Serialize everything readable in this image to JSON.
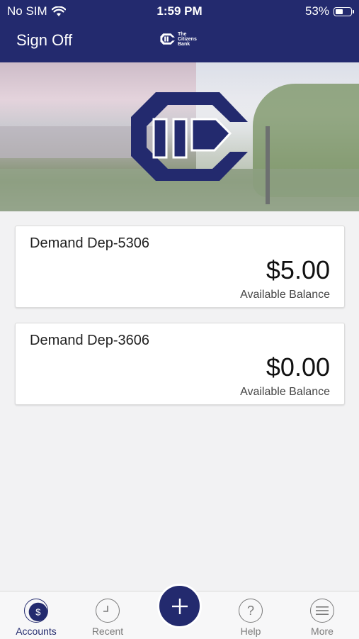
{
  "status_bar": {
    "carrier": "No SIM",
    "time": "1:59 PM",
    "battery_percent": "53%",
    "battery_level": 0.53
  },
  "header": {
    "sign_off_label": "Sign Off",
    "logo_text": [
      "The",
      "Citizens",
      "Bank"
    ],
    "logo_icon": "tcb-logo-icon"
  },
  "accounts": [
    {
      "name": "Demand Dep-5306",
      "amount": "$5.00",
      "balance_label": "Available Balance"
    },
    {
      "name": "Demand Dep-3606",
      "amount": "$0.00",
      "balance_label": "Available Balance"
    }
  ],
  "tabs": [
    {
      "label": "Accounts",
      "icon": "dollar-icon",
      "active": true
    },
    {
      "label": "Recent",
      "icon": "clock-icon",
      "active": false
    },
    {
      "label": "Help",
      "icon": "question-icon",
      "active": false
    },
    {
      "label": "More",
      "icon": "menu-icon",
      "active": false
    }
  ],
  "fab": {
    "icon": "plus-icon"
  },
  "colors": {
    "brand_navy": "#232a6e",
    "background": "#f2f2f3",
    "tab_inactive": "#7a7a7a"
  }
}
